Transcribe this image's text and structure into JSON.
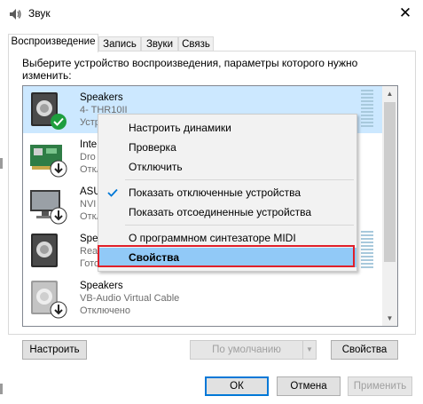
{
  "window": {
    "title": "Звук"
  },
  "tabs": [
    {
      "label": "Воспроизведение",
      "active": true
    },
    {
      "label": "Запись"
    },
    {
      "label": "Звуки"
    },
    {
      "label": "Связь"
    }
  ],
  "instruction": "Выберите устройство воспроизведения, параметры которого нужно изменить:",
  "devices": [
    {
      "name": "Speakers",
      "sub": "4- THR10II",
      "status": "Устр",
      "icon": "speaker-icon",
      "badge": "default-check-icon",
      "selected": true
    },
    {
      "name": "Inte",
      "sub": "Dro",
      "status": "Откл",
      "icon": "sound-card-icon",
      "badge": "disabled-arrow-icon"
    },
    {
      "name": "ASU",
      "sub": "NVI",
      "status": "Откл",
      "icon": "monitor-icon",
      "badge": "disabled-arrow-icon"
    },
    {
      "name": "Spe",
      "sub": "Rea",
      "status": "Гото",
      "icon": "speaker-icon"
    },
    {
      "name": "Speakers",
      "sub": "VB-Audio Virtual Cable",
      "status": "Отключено",
      "icon": "speaker-icon",
      "badge": "disabled-arrow-icon"
    }
  ],
  "context_menu": {
    "items": [
      {
        "label": "Настроить динамики"
      },
      {
        "label": "Проверка"
      },
      {
        "label": "Отключить"
      },
      {
        "label": "Показать отключенные устройства",
        "checked": true
      },
      {
        "label": "Показать отсоединенные устройства"
      },
      {
        "label": "О программном синтезаторе MIDI"
      },
      {
        "label": "Свойства",
        "bold": true,
        "hovered": true,
        "highlighted": true
      }
    ]
  },
  "buttons": {
    "configure": "Настроить",
    "set_default": "По умолчанию",
    "properties": "Свойства",
    "ok": "ОК",
    "cancel": "Отмена",
    "apply": "Применить"
  },
  "colors": {
    "selection": "#cce8ff",
    "menu_hover": "#91c9f7",
    "highlight_frame": "#e0202a",
    "default_check": "#1e9e3e",
    "accent": "#0078d7"
  }
}
